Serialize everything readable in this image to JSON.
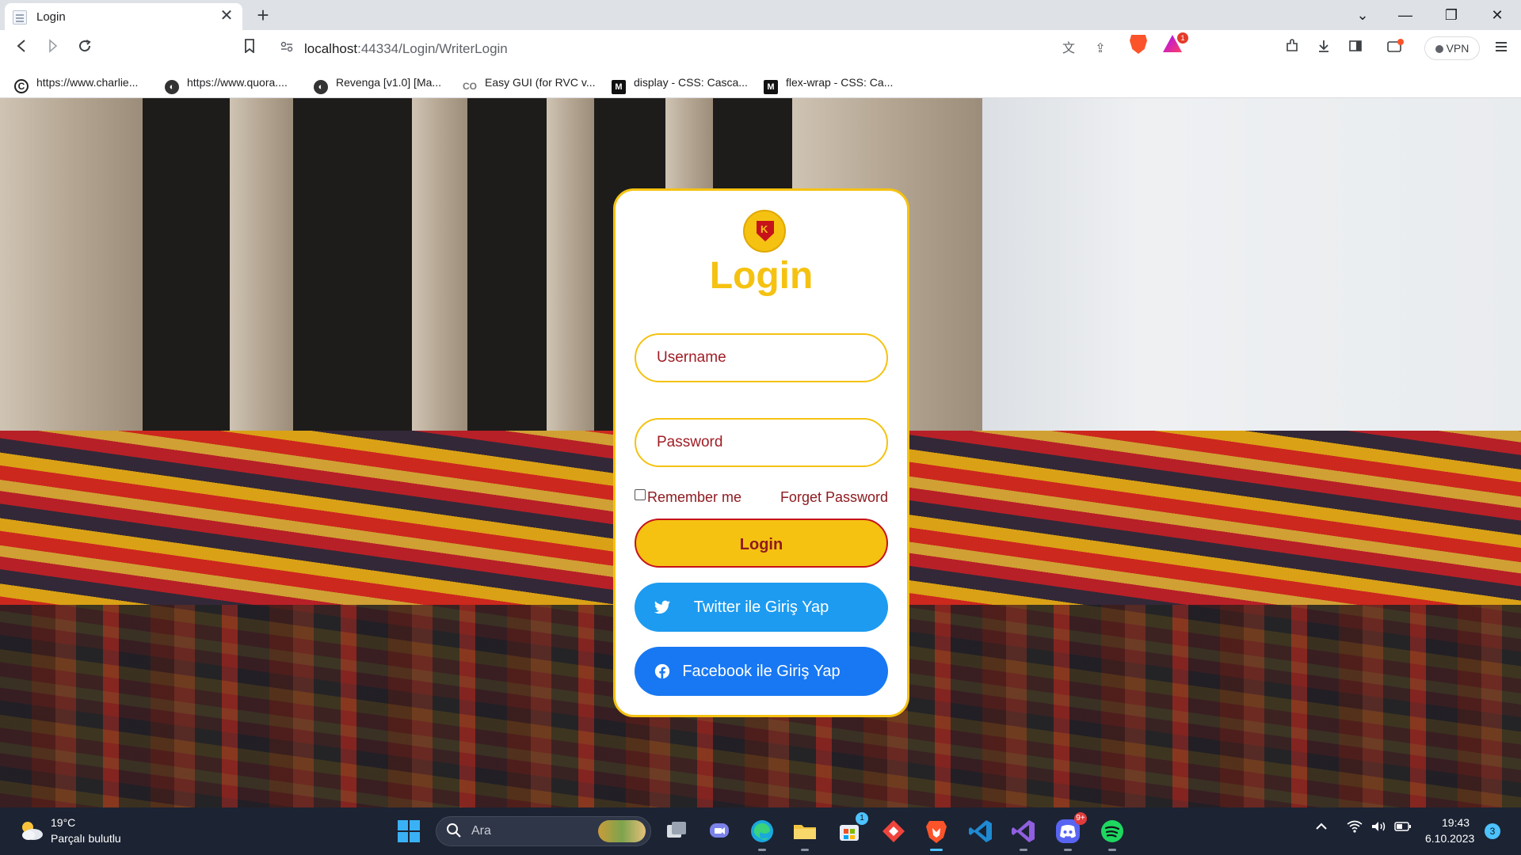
{
  "browser": {
    "tab": {
      "title": "Login",
      "close": "✕"
    },
    "new_tab": "+",
    "window_controls": {
      "tabsearch": "⌄",
      "minimize": "—",
      "restore": "❐",
      "close": "✕"
    },
    "url": {
      "host": "localhost",
      "rest": ":44334/Login/WriterLogin"
    },
    "rewards_badge": "1",
    "vpn_label": "VPN",
    "bookmarks": [
      {
        "label": "https://www.charlie...",
        "icon": "charlie-c-icon"
      },
      {
        "label": "https://www.quora....",
        "icon": "globe-icon"
      },
      {
        "label": "Revenga [v1.0] [Ma...",
        "icon": "globe-icon"
      },
      {
        "label": "Easy GUI (for RVC v...",
        "icon": "colab-icon"
      },
      {
        "label": "display - CSS: Casca...",
        "icon": "mdn-icon"
      },
      {
        "label": "flex-wrap - CSS: Ca...",
        "icon": "mdn-icon"
      }
    ]
  },
  "login": {
    "title": "Login",
    "username_placeholder": "Username",
    "password_placeholder": "Password",
    "remember_label": "Remember me",
    "forget_label": "Forget Password",
    "login_button": "Login",
    "twitter_button": "Twitter ile Giriş Yap",
    "facebook_button": "Facebook ile Giriş Yap",
    "colors": {
      "accent": "#f5c211",
      "text": "#8e1b20",
      "twitter": "#1d9bf0",
      "facebook": "#1877f2"
    }
  },
  "taskbar": {
    "weather_temp": "19°C",
    "weather_desc": "Parçalı bulutlu",
    "search_placeholder": "Ara",
    "store_badge": "1",
    "discord_badge": "9+",
    "time": "19:43",
    "date": "6.10.2023",
    "notification_count": "3"
  }
}
